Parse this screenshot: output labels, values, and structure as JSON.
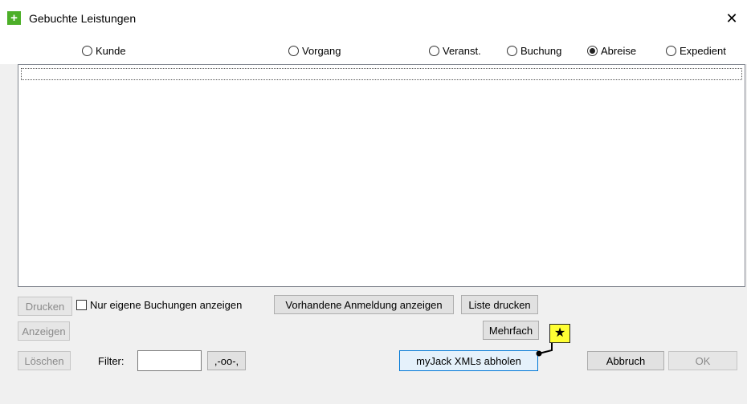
{
  "window": {
    "title": "Gebuchte Leistungen",
    "close_glyph": "✕",
    "app_icon_glyph": "+"
  },
  "radios": [
    {
      "label": "Kunde",
      "checked": false
    },
    {
      "label": "Vorgang",
      "checked": false
    },
    {
      "label": "Veranst.",
      "checked": false
    },
    {
      "label": "Buchung",
      "checked": false
    },
    {
      "label": "Abreise",
      "checked": true
    },
    {
      "label": "Expedient",
      "checked": false
    }
  ],
  "buttons": {
    "drucken": "Drucken",
    "anzeigen": "Anzeigen",
    "loeschen": "Löschen",
    "vorhandene": "Vorhandene Anmeldung anzeigen",
    "liste_drucken": "Liste drucken",
    "mehrfach": "Mehrfach",
    "myjack": "myJack XMLs abholen",
    "abbruch": "Abbruch",
    "ok": "OK",
    "filter_reset": ",-oo-,"
  },
  "checkbox": {
    "label": "Nur eigene Buchungen anzeigen",
    "checked": false
  },
  "filter": {
    "label": "Filter:",
    "value": ""
  },
  "callout": {
    "glyph": "★"
  },
  "colors": {
    "accent": "#0078d7",
    "callout": "#ffff33",
    "icon_green": "#4caf28"
  }
}
